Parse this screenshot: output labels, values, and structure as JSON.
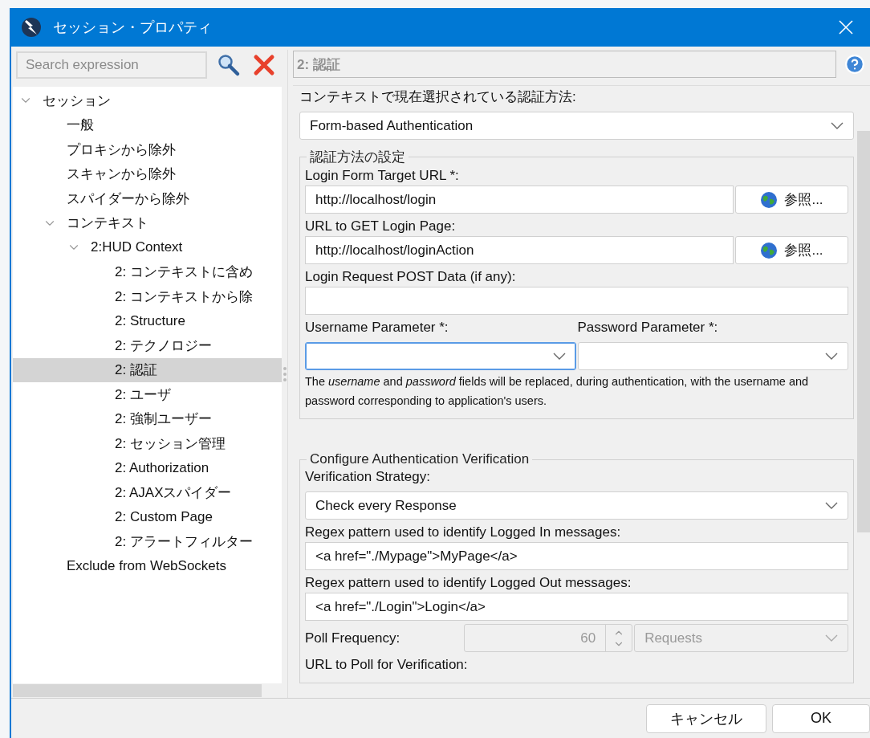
{
  "window": {
    "title": "セッション・プロパティ"
  },
  "sidebar": {
    "search": {
      "placeholder": "Search expression"
    },
    "tree": [
      {
        "label": "セッション",
        "expanded": true,
        "selected": false,
        "children": [
          {
            "label": "一般",
            "selected": false
          },
          {
            "label": "プロキシから除外",
            "selected": false
          },
          {
            "label": "スキャンから除外",
            "selected": false
          },
          {
            "label": "スパイダーから除外",
            "selected": false
          },
          {
            "label": "コンテキスト",
            "expanded": true,
            "selected": false,
            "children": [
              {
                "label": "2:HUD Context",
                "expanded": true,
                "selected": false,
                "children": [
                  {
                    "label": "2: コンテキストに含め",
                    "selected": false
                  },
                  {
                    "label": "2: コンテキストから除",
                    "selected": false
                  },
                  {
                    "label": "2: Structure",
                    "selected": false
                  },
                  {
                    "label": "2: テクノロジー",
                    "selected": false
                  },
                  {
                    "label": "2: 認証",
                    "selected": true
                  },
                  {
                    "label": "2: ユーザ",
                    "selected": false
                  },
                  {
                    "label": "2: 強制ユーザー",
                    "selected": false
                  },
                  {
                    "label": "2: セッション管理",
                    "selected": false
                  },
                  {
                    "label": "2: Authorization",
                    "selected": false
                  },
                  {
                    "label": "2: AJAXスパイダー",
                    "selected": false
                  },
                  {
                    "label": "2: Custom Page",
                    "selected": false
                  },
                  {
                    "label": "2: アラートフィルター",
                    "selected": false
                  }
                ]
              }
            ]
          },
          {
            "label": "Exclude from WebSockets",
            "selected": false
          }
        ]
      }
    ]
  },
  "panel": {
    "title": "2: 認証",
    "method": {
      "label": "コンテキストで現在選択されている認証方法:",
      "value": "Form-based Authentication"
    },
    "settings": {
      "title": "認証方法の設定",
      "login_form_url": {
        "label": "Login Form Target URL *:",
        "value": "http://localhost/login",
        "button": "参照..."
      },
      "login_page_url": {
        "label": "URL to GET Login Page:",
        "value": "http://localhost/loginAction",
        "button": "参照..."
      },
      "post_data": {
        "label": "Login Request POST Data (if any):"
      },
      "username_param": {
        "label": "Username Parameter *:",
        "focused": true
      },
      "password_param": {
        "label": "Password Parameter *:",
        "focused": false
      },
      "note": "The *username* and *password* fields will be replaced, during authentication, with the username and password corresponding to application's users."
    },
    "verification": {
      "title": "Configure Authentication Verification",
      "strategy": {
        "label": "Verification Strategy:",
        "value": "Check every Response"
      },
      "logged_in": {
        "label": "Regex pattern used to identify Logged In messages:",
        "value": "<a href=\"./Mypage\">MyPage</a>"
      },
      "logged_out": {
        "label": "Regex pattern used to identify Logged Out messages:",
        "value": "<a href=\"./Login\">Login</a>"
      },
      "poll": {
        "label": "Poll Frequency:",
        "value": "60",
        "unit": "Requests",
        "disabled": true
      },
      "poll_url": {
        "label": "URL to Poll for Verification:"
      }
    }
  },
  "buttons": [
    {
      "label": "キャンセル"
    },
    {
      "label": "OK"
    }
  ]
}
